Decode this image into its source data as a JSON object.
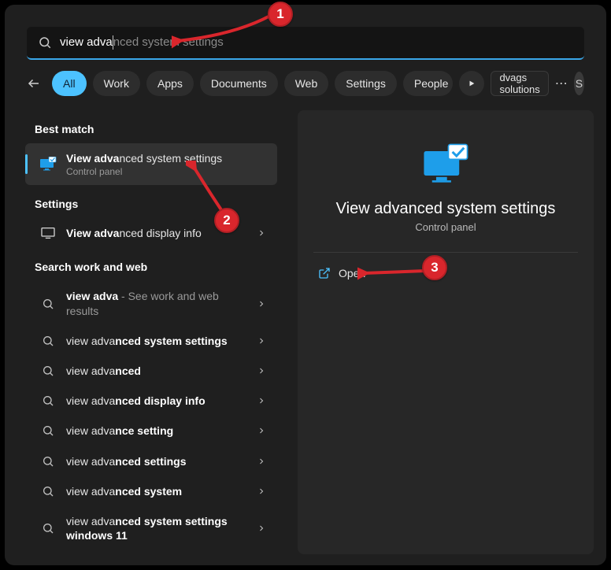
{
  "search": {
    "typed": "view adva",
    "suggestion_tail": "nced system settings"
  },
  "filters": {
    "items": [
      "All",
      "Work",
      "Apps",
      "Documents",
      "Web",
      "Settings",
      "People"
    ],
    "active_index": 0
  },
  "brand_chip": "dvags solutions",
  "avatar_initial": "S",
  "left": {
    "best_match_heading": "Best match",
    "best_match": {
      "title_bold": "View adva",
      "title_rest": "nced system settings",
      "subtitle": "Control panel"
    },
    "settings_heading": "Settings",
    "settings_items": [
      {
        "bold": "View adva",
        "rest": "nced display info"
      }
    ],
    "web_heading": "Search work and web",
    "web_items": [
      {
        "bold": "view adva",
        "rest": " - See work and web results"
      },
      {
        "pre": "view adva",
        "bold": "nced system settings",
        "rest": ""
      },
      {
        "pre": "view adva",
        "bold": "nced",
        "rest": ""
      },
      {
        "pre": "view adva",
        "bold": "nced display info",
        "rest": ""
      },
      {
        "pre": "view adva",
        "bold": "nce setting",
        "rest": ""
      },
      {
        "pre": "view adva",
        "bold": "nced settings",
        "rest": ""
      },
      {
        "pre": "view adva",
        "bold": "nced system",
        "rest": ""
      },
      {
        "pre": "view adva",
        "bold": "nced system settings windows 11",
        "rest": ""
      }
    ]
  },
  "right": {
    "title": "View advanced system settings",
    "subtitle": "Control panel",
    "open_label": "Open"
  },
  "annotations": {
    "callouts": [
      "1",
      "2",
      "3"
    ]
  }
}
